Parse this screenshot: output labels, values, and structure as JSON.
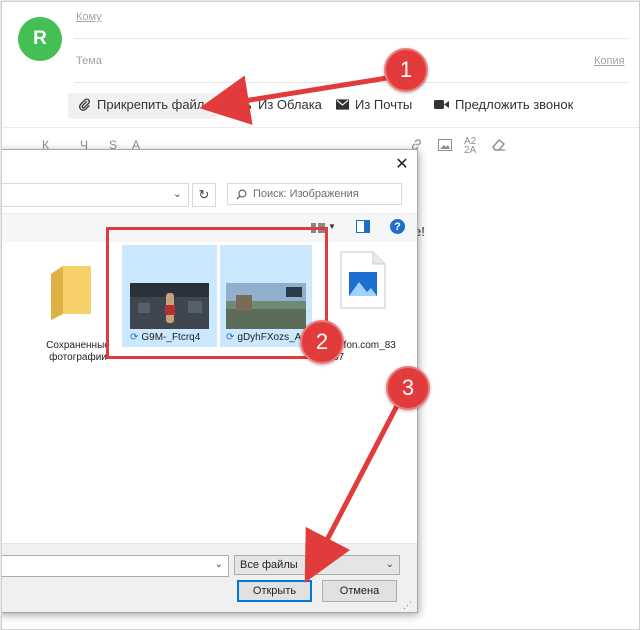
{
  "compose": {
    "avatar_letter": "R",
    "to_label": "Кому",
    "subject_label": "Тема",
    "copy_link": "Копия",
    "body_fragment": "e!"
  },
  "toolbar": {
    "attach_label": "Прикрепить файл",
    "cloud_label": "Из Облака",
    "mail_label": "Из Почты",
    "call_label": "Предложить звонок"
  },
  "format_bar": [
    "К",
    "Ч",
    "S",
    "A"
  ],
  "dialog": {
    "close_glyph": "✕",
    "search_placeholder": "Поиск: Изображения",
    "files": [
      {
        "name_line1": "Сохраненные",
        "name_line2": "фотографии"
      },
      {
        "name": "G9M-_Ftcrq4"
      },
      {
        "name": "gDyhFXozs_A"
      },
      {
        "name_line1": "uxfon.com_83",
        "name_line2": "67"
      }
    ],
    "left_fragment": "и",
    "filetype_label": "Все файлы",
    "open_button": "Открыть",
    "cancel_button": "Отмена"
  },
  "annotations": {
    "step1": "1",
    "step2": "2",
    "step3": "3",
    "accent_color": "#e23b3b"
  }
}
